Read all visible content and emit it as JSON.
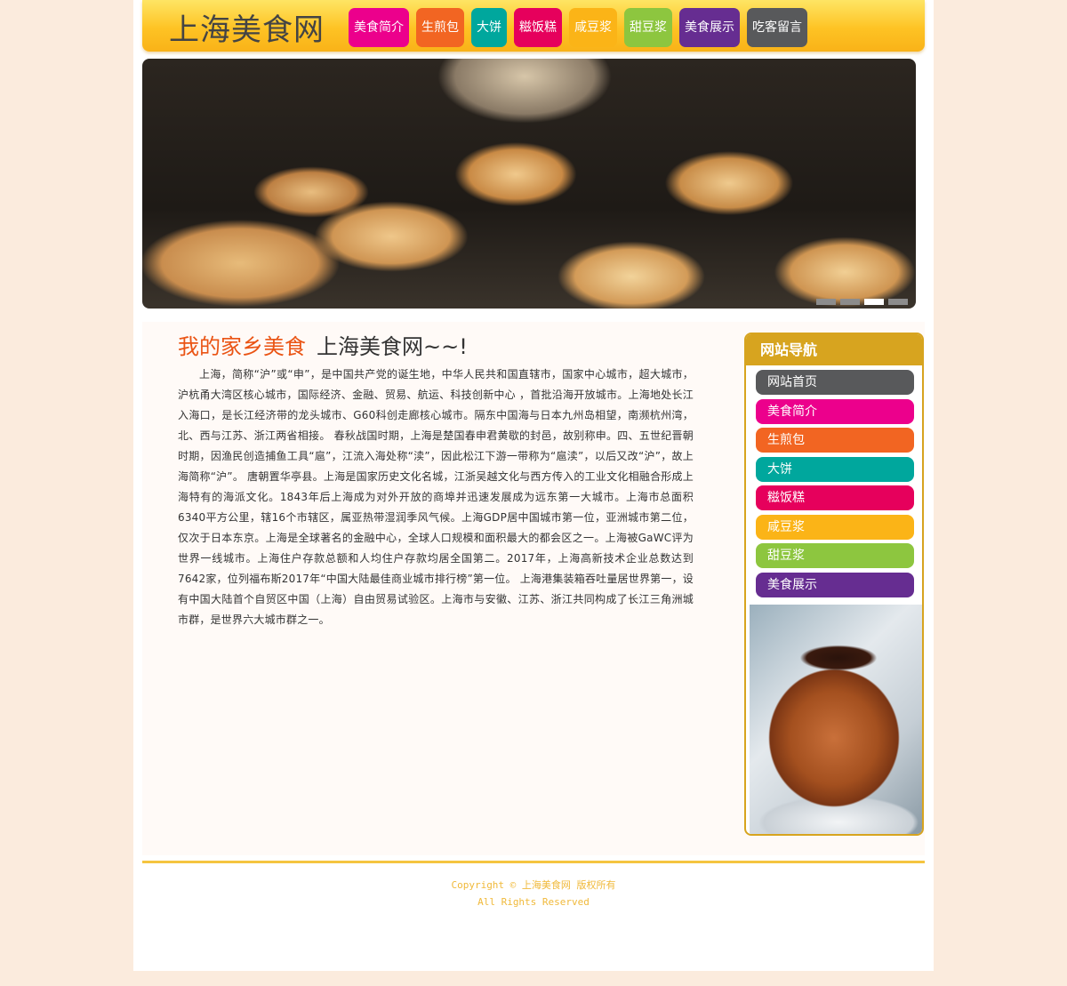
{
  "site": {
    "title": "上海美食网"
  },
  "nav": {
    "items": [
      {
        "label": "美食简介",
        "color": "#ec008c"
      },
      {
        "label": "生煎包",
        "color": "#f26522"
      },
      {
        "label": "大饼",
        "color": "#00a79d"
      },
      {
        "label": "糍饭糕",
        "color": "#e6005c"
      },
      {
        "label": "咸豆浆",
        "color": "#fbb417"
      },
      {
        "label": "甜豆浆",
        "color": "#8dc63f"
      },
      {
        "label": "美食展示",
        "color": "#662d91"
      },
      {
        "label": "吃客留言",
        "color": "#58595b"
      }
    ]
  },
  "banner": {
    "active_slide": 3,
    "slide_count": 4
  },
  "article": {
    "title_part1": "我的家乡美食",
    "title_part2": "上海美食网~~!",
    "body": "上海，简称“沪”或“申”，是中国共产党的诞生地，中华人民共和国直辖市，国家中心城市，超大城市，沪杭甬大湾区核心城市，国际经济、金融、贸易、航运、科技创新中心 ，首批沿海开放城市。上海地处长江入海口，是长江经济带的龙头城市、G60科创走廊核心城市。隔东中国海与日本九州岛相望，南濒杭州湾，北、西与江苏、浙江两省相接。 春秋战国时期，上海是楚国春申君黄歇的封邑，故别称申。四、五世纪晋朝时期，因渔民创造捕鱼工具“扈”，江流入海处称“渎”，因此松江下游一带称为“扈渎”，以后又改“沪”，故上海简称“沪”。 唐朝置华亭县。上海是国家历史文化名城，江浙吴越文化与西方传入的工业文化相融合形成上海特有的海派文化。1843年后上海成为对外开放的商埠并迅速发展成为远东第一大城市。上海市总面积6340平方公里，辖16个市辖区，属亚热带湿润季风气候。上海GDP居中国城市第一位，亚洲城市第二位，仅次于日本东京。上海是全球著名的金融中心，全球人口规模和面积最大的都会区之一。上海被GaWC评为世界一线城市。上海住户存款总额和人均住户存款均居全国第二。2017年，上海高新技术企业总数达到7642家，位列福布斯2017年“中国大陆最佳商业城市排行榜”第一位。 上海港集装箱吞吐量居世界第一，设有中国大陆首个自贸区中国（上海）自由贸易试验区。上海市与安徽、江苏、浙江共同构成了长江三角洲城市群，是世界六大城市群之一。"
  },
  "sidebar": {
    "heading": "网站导航",
    "items": [
      {
        "label": "网站首页",
        "color": "#58595b"
      },
      {
        "label": "美食简介",
        "color": "#ec008c"
      },
      {
        "label": "生煎包",
        "color": "#f26522"
      },
      {
        "label": "大饼",
        "color": "#00a79d"
      },
      {
        "label": "糍饭糕",
        "color": "#e6005c"
      },
      {
        "label": "咸豆浆",
        "color": "#fbb417"
      },
      {
        "label": "甜豆浆",
        "color": "#8dc63f"
      },
      {
        "label": "美食展示",
        "color": "#662d91"
      }
    ]
  },
  "footer": {
    "copyright": "Copyright © 上海美食网 版权所有",
    "rights": "All Rights Reserved"
  },
  "colors": {
    "accent_gold": "#d7a41f",
    "header_yellow": "#fec324",
    "page_bg": "#fbebdd"
  }
}
